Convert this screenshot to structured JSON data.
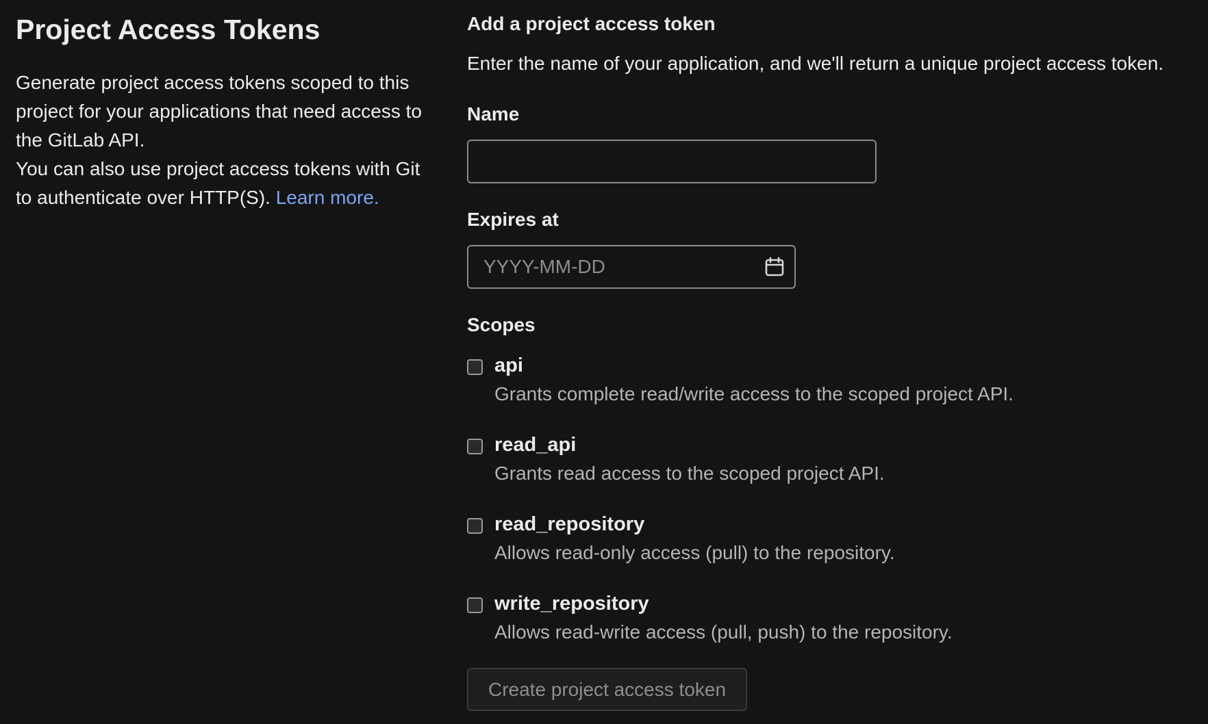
{
  "left": {
    "title": "Project Access Tokens",
    "description_1": "Generate project access tokens scoped to this project for your applications that need access to the GitLab API.",
    "description_2": "You can also use project access tokens with Git to authenticate over HTTP(S).",
    "learn_more": "Learn more."
  },
  "form": {
    "title": "Add a project access token",
    "description": "Enter the name of your application, and we'll return a unique project access token.",
    "name_label": "Name",
    "name_value": "",
    "expires_label": "Expires at",
    "expires_placeholder": "YYYY-MM-DD",
    "calendar_icon": "calendar-icon",
    "scopes_label": "Scopes",
    "scopes": [
      {
        "name": "api",
        "description": "Grants complete read/write access to the scoped project API.",
        "checked": false
      },
      {
        "name": "read_api",
        "description": "Grants read access to the scoped project API.",
        "checked": false
      },
      {
        "name": "read_repository",
        "description": "Allows read-only access (pull) to the repository.",
        "checked": false
      },
      {
        "name": "write_repository",
        "description": "Allows read-write access (pull, push) to the repository.",
        "checked": false
      }
    ],
    "submit_label": "Create project access token"
  }
}
